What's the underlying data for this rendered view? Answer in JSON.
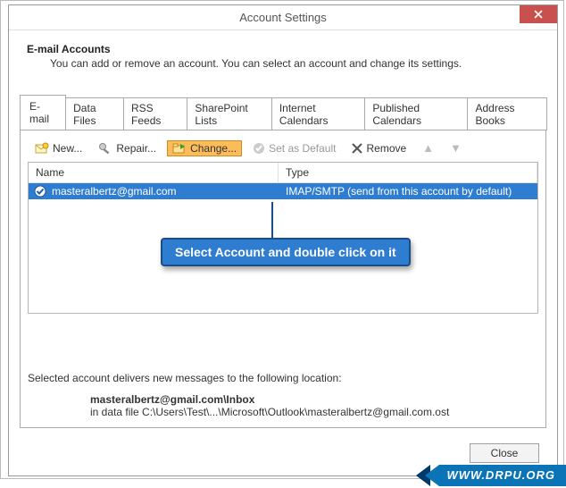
{
  "window": {
    "title": "Account Settings"
  },
  "intro": {
    "heading": "E-mail Accounts",
    "sub": "You can add or remove an account. You can select an account and change its settings."
  },
  "tabs": [
    {
      "label": "E-mail"
    },
    {
      "label": "Data Files"
    },
    {
      "label": "RSS Feeds"
    },
    {
      "label": "SharePoint Lists"
    },
    {
      "label": "Internet Calendars"
    },
    {
      "label": "Published Calendars"
    },
    {
      "label": "Address Books"
    }
  ],
  "toolbar": {
    "new": "New...",
    "repair": "Repair...",
    "change": "Change...",
    "setdefault": "Set as Default",
    "remove": "Remove"
  },
  "list": {
    "col_name": "Name",
    "col_type": "Type",
    "rows": [
      {
        "name": "masteralbertz@gmail.com",
        "type": "IMAP/SMTP (send from this account by default)"
      }
    ]
  },
  "callout": {
    "text": "Select Account and double click on it"
  },
  "footer": {
    "line1": "Selected account delivers new messages to the following location:",
    "bold": "masteralbertz@gmail.com\\Inbox",
    "path": "in data file C:\\Users\\Test\\...\\Microsoft\\Outlook\\masteralbertz@gmail.com.ost"
  },
  "dialog": {
    "close": "Close"
  },
  "watermark": {
    "text": "WWW.DRPU.ORG"
  }
}
